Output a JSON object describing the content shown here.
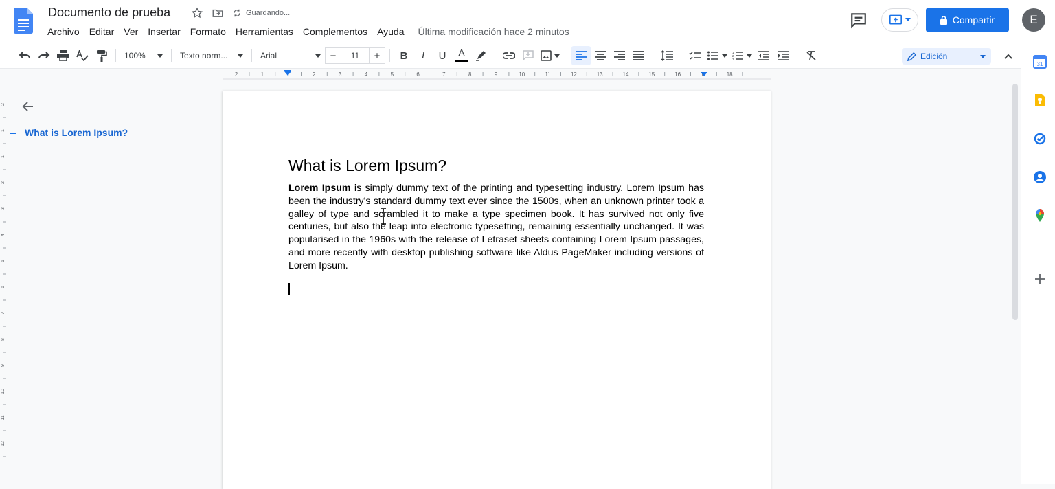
{
  "doc": {
    "title": "Documento de prueba",
    "saving_status": "Guardando...",
    "last_modified": "Última modificación hace 2 minutos"
  },
  "menu": [
    "Archivo",
    "Editar",
    "Ver",
    "Insertar",
    "Formato",
    "Herramientas",
    "Complementos",
    "Ayuda"
  ],
  "share": {
    "label": "Compartir"
  },
  "avatar": {
    "initial": "E"
  },
  "toolbar": {
    "zoom": "100%",
    "style": "Texto norm...",
    "font": "Arial",
    "font_size": "11",
    "bold": "B",
    "italic": "I",
    "underline": "U",
    "text_color": "A",
    "mode": "Edición"
  },
  "ruler": {
    "top_marks": [
      "2",
      "1",
      "1",
      "2",
      "3",
      "4",
      "5",
      "6",
      "7",
      "8",
      "9",
      "10",
      "11",
      "12",
      "13",
      "14",
      "15",
      "16",
      "17",
      "18"
    ],
    "left_marks": [
      "2",
      "1",
      "1",
      "2",
      "3",
      "4",
      "5",
      "6",
      "7",
      "8",
      "9",
      "10",
      "11",
      "12"
    ]
  },
  "outline": {
    "heading": "What is Lorem Ipsum?"
  },
  "content": {
    "heading": "What is Lorem Ipsum?",
    "bold_lead": "Lorem Ipsum",
    "body": " is simply dummy text of the printing and typesetting industry. Lorem Ipsum has been the industry's standard dummy text ever since the 1500s, when an unknown printer took a galley of type and scrambled it to make a type specimen book. It has survived not only five centuries, but also the leap into electronic typesetting, remaining essentially unchanged. It was popularised in the 1960s with the release of Letraset sheets containing Lorem Ipsum passages, and more recently with desktop publishing software like Aldus PageMaker including versions of Lorem Ipsum."
  },
  "colors": {
    "accent": "#1a73e8",
    "outline_text": "#1967d2",
    "calendar": "#4285f4",
    "keep": "#fbbc04",
    "tasks": "#1a73e8",
    "contacts": "#1a73e8"
  },
  "side_panel": {
    "calendar_day": "31"
  }
}
